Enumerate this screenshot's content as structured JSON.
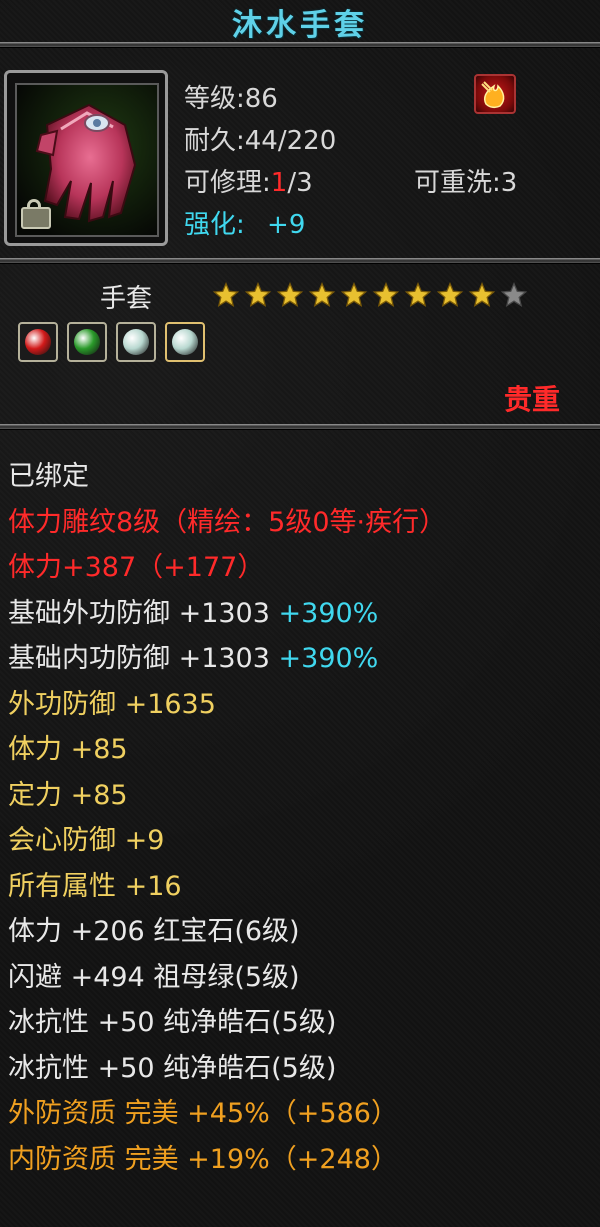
{
  "item": {
    "name": "沐水手套",
    "level_text": "等级:86",
    "durability_text": "耐久:44/220",
    "repair_label": "可修理:",
    "repair_current": "1",
    "repair_max": "/3",
    "rewash_text": "可重洗:3",
    "enhance_label": "强化:",
    "enhance_value": "+9",
    "type": "手套",
    "stars_filled": 9,
    "stars_total": 10,
    "rarity": "贵重"
  },
  "gems": [
    {
      "name": "ruby-gem-icon",
      "color": "#d21a1a"
    },
    {
      "name": "emerald-gem-icon",
      "color": "#2a9a2a"
    },
    {
      "name": "diamond-gem-icon",
      "color": "#b8d8d0"
    },
    {
      "name": "diamond-gem-icon",
      "color": "#b8d8d0"
    }
  ],
  "attributes": [
    {
      "parts": [
        {
          "text": "已绑定",
          "color": "white"
        }
      ]
    },
    {
      "parts": [
        {
          "text": "体力雕纹8级（精绘：5级0等·疾行）",
          "color": "red"
        }
      ]
    },
    {
      "parts": [
        {
          "text": "体力+387（+177）",
          "color": "red"
        }
      ]
    },
    {
      "parts": [
        {
          "text": "基础外功防御 +1303 ",
          "color": "white"
        },
        {
          "text": "+390%",
          "color": "cyan"
        }
      ]
    },
    {
      "parts": [
        {
          "text": "基础内功防御 +1303 ",
          "color": "white"
        },
        {
          "text": "+390%",
          "color": "cyan"
        }
      ]
    },
    {
      "parts": [
        {
          "text": "外功防御 +1635",
          "color": "yellow"
        }
      ]
    },
    {
      "parts": [
        {
          "text": "体力 +85",
          "color": "yellow"
        }
      ]
    },
    {
      "parts": [
        {
          "text": "定力 +85",
          "color": "yellow"
        }
      ]
    },
    {
      "parts": [
        {
          "text": "会心防御 +9",
          "color": "yellow"
        }
      ]
    },
    {
      "parts": [
        {
          "text": "所有属性 +16",
          "color": "yellow"
        }
      ]
    },
    {
      "parts": [
        {
          "text": "体力 +206 红宝石(6级)",
          "color": "white"
        }
      ]
    },
    {
      "parts": [
        {
          "text": "闪避 +494 祖母绿(5级)",
          "color": "white"
        }
      ]
    },
    {
      "parts": [
        {
          "text": "冰抗性 +50 纯净皓石(5级)",
          "color": "white"
        }
      ]
    },
    {
      "parts": [
        {
          "text": "冰抗性 +50 纯净皓石(5级)",
          "color": "white"
        }
      ]
    },
    {
      "parts": [
        {
          "text": "外防资质  完美 +45%（+586）",
          "color": "orange"
        }
      ]
    },
    {
      "parts": [
        {
          "text": "内防资质  完美 +19%（+248）",
          "color": "orange"
        }
      ]
    }
  ]
}
